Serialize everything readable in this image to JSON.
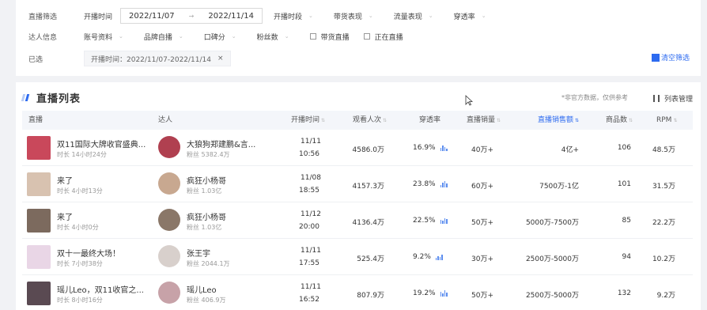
{
  "filters": {
    "live_filter_label": "直播筛选",
    "start_time_label": "开播时间",
    "date_start": "2022/11/07",
    "date_end": "2022/11/14",
    "dropdowns_row1": [
      "开播时段",
      "带货表现",
      "流量表现",
      "穿透率"
    ],
    "influencer_label": "达人信息",
    "dropdowns_row2": [
      "账号资料",
      "品牌自播",
      "口碑分",
      "粉丝数"
    ],
    "checkbox_goods": "带货直播",
    "checkbox_live": "正在直播",
    "selected_label": "已选",
    "selected_tag": "开播时间：2022/11/07-2022/11/14",
    "clear_label": "清空筛选"
  },
  "list": {
    "title": "直播列表",
    "note": "*非官方数据，仅供参考",
    "manage_label": "列表管理",
    "columns": {
      "live": "直播",
      "influencer": "达人",
      "start_time": "开播时间",
      "viewers": "观看人次",
      "penetration": "穿透率",
      "sales_volume": "直播销量",
      "sales_amount": "直播销售额",
      "product_count": "商品数",
      "rpm": "RPM"
    },
    "rows": [
      {
        "title": "双11国际大牌收官盛典...",
        "duration": "时长 14小时24分",
        "name": "大狼狗郑建鹏&言...",
        "fans": "粉丝 5382.4万",
        "date": "11/11",
        "time": "10:56",
        "viewers": "4586.0万",
        "penetration": "16.9%",
        "volume": "40万+",
        "amount": "4亿+",
        "products": "106",
        "rpm": "48.5万"
      },
      {
        "title": "来了",
        "duration": "时长 4小时13分",
        "name": "疯狂小杨哥",
        "fans": "粉丝 1.03亿",
        "date": "11/08",
        "time": "18:55",
        "viewers": "4157.3万",
        "penetration": "23.8%",
        "volume": "60万+",
        "amount": "7500万-1亿",
        "products": "101",
        "rpm": "31.5万"
      },
      {
        "title": "来了",
        "duration": "时长 4小时0分",
        "name": "疯狂小杨哥",
        "fans": "粉丝 1.03亿",
        "date": "11/12",
        "time": "20:00",
        "viewers": "4136.4万",
        "penetration": "22.5%",
        "volume": "50万+",
        "amount": "5000万-7500万",
        "products": "85",
        "rpm": "22.2万"
      },
      {
        "title": "双十一最终大场！",
        "duration": "时长 7小时38分",
        "name": "张王宇",
        "fans": "粉丝 2044.1万",
        "date": "11/11",
        "time": "17:55",
        "viewers": "525.4万",
        "penetration": "9.2%",
        "volume": "30万+",
        "amount": "2500万-5000万",
        "products": "94",
        "rpm": "10.2万"
      },
      {
        "title": "瑶儿Leo，双11收官之...",
        "duration": "时长 8小时16分",
        "name": "瑶儿Leo",
        "fans": "粉丝 406.9万",
        "date": "11/11",
        "time": "16:52",
        "viewers": "807.9万",
        "penetration": "19.2%",
        "volume": "50万+",
        "amount": "2500万-5000万",
        "products": "132",
        "rpm": "9.2万"
      }
    ]
  },
  "colors": {
    "accent": "#2d6bf0",
    "background": "#f1f2f5",
    "header_bar": "#f4f6fa"
  }
}
